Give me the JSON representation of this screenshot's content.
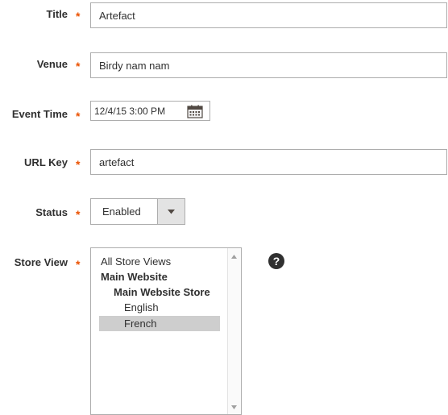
{
  "form": {
    "title": {
      "label": "Title",
      "value": "Artefact"
    },
    "venue": {
      "label": "Venue",
      "value": "Birdy nam nam"
    },
    "event_time": {
      "label": "Event Time",
      "value": "12/4/15 3:00 PM"
    },
    "url_key": {
      "label": "URL Key",
      "value": "artefact"
    },
    "status": {
      "label": "Status",
      "value": "Enabled"
    },
    "store_view": {
      "label": "Store View",
      "options": [
        {
          "label": "All Store Views",
          "level": 0,
          "group": false,
          "selected": false
        },
        {
          "label": "Main Website",
          "level": 0,
          "group": true,
          "selected": false
        },
        {
          "label": "Main Website Store",
          "level": 1,
          "group": true,
          "selected": false
        },
        {
          "label": "English",
          "level": 2,
          "group": false,
          "selected": false
        },
        {
          "label": "French",
          "level": 2,
          "group": false,
          "selected": true
        }
      ]
    },
    "required_marker": "*",
    "help_symbol": "?"
  },
  "colors": {
    "required": "#eb5202",
    "border": "#adadad",
    "selected_option": "#cecece"
  },
  "icons": [
    "calendar-icon",
    "chevron-down-icon",
    "scroll-up-icon",
    "scroll-down-icon",
    "help-icon"
  ]
}
